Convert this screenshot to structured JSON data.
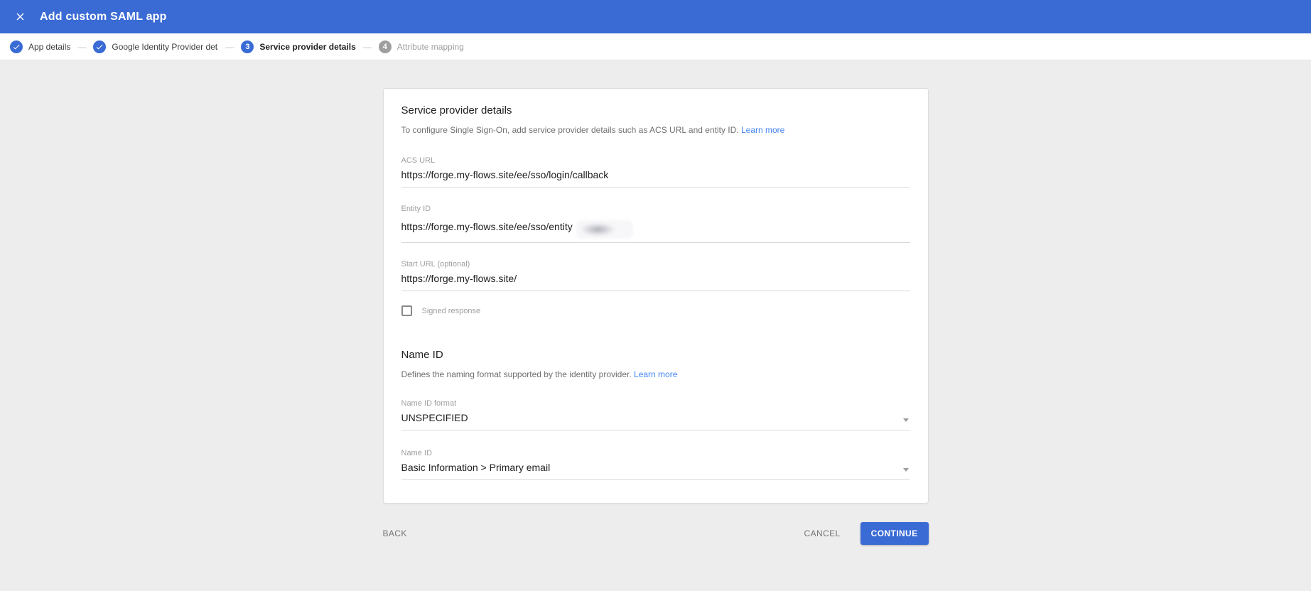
{
  "header": {
    "title": "Add custom SAML app"
  },
  "stepper": {
    "separator": "—",
    "steps": [
      {
        "label": "App details",
        "state": "completed"
      },
      {
        "label": "Google Identity Provider details",
        "state": "completed"
      },
      {
        "label": "Service provider details",
        "state": "current",
        "number": "3"
      },
      {
        "label": "Attribute mapping",
        "state": "upcoming",
        "number": "4"
      }
    ]
  },
  "card": {
    "title": "Service provider details",
    "description": "To configure Single Sign-On, add service provider details such as ACS URL and entity ID.",
    "learn_more": "Learn more",
    "fields": {
      "acs_url": {
        "label": "ACS URL",
        "value": "https://forge.my-flows.site/ee/sso/login/callback"
      },
      "entity_id": {
        "label": "Entity ID",
        "value": "https://forge.my-flows.site/ee/sso/entity",
        "redacted": true
      },
      "start_url": {
        "label": "Start URL (optional)",
        "value": "https://forge.my-flows.site/"
      },
      "signed_response": {
        "label": "Signed response",
        "checked": false
      }
    },
    "name_id_section": {
      "title": "Name ID",
      "description": "Defines the naming format supported by the identity provider.",
      "learn_more": "Learn more",
      "format_field": {
        "label": "Name ID format",
        "value": "UNSPECIFIED"
      },
      "name_id_field": {
        "label": "Name ID",
        "value": "Basic Information > Primary email"
      }
    }
  },
  "footer": {
    "back": "BACK",
    "cancel": "CANCEL",
    "continue": "CONTINUE"
  },
  "colors": {
    "primary_blue": "#3a6bd5",
    "link_blue": "#4285f4",
    "background_gray": "#ededed",
    "label_gray": "#9e9e9e",
    "text_dark": "#212121"
  }
}
